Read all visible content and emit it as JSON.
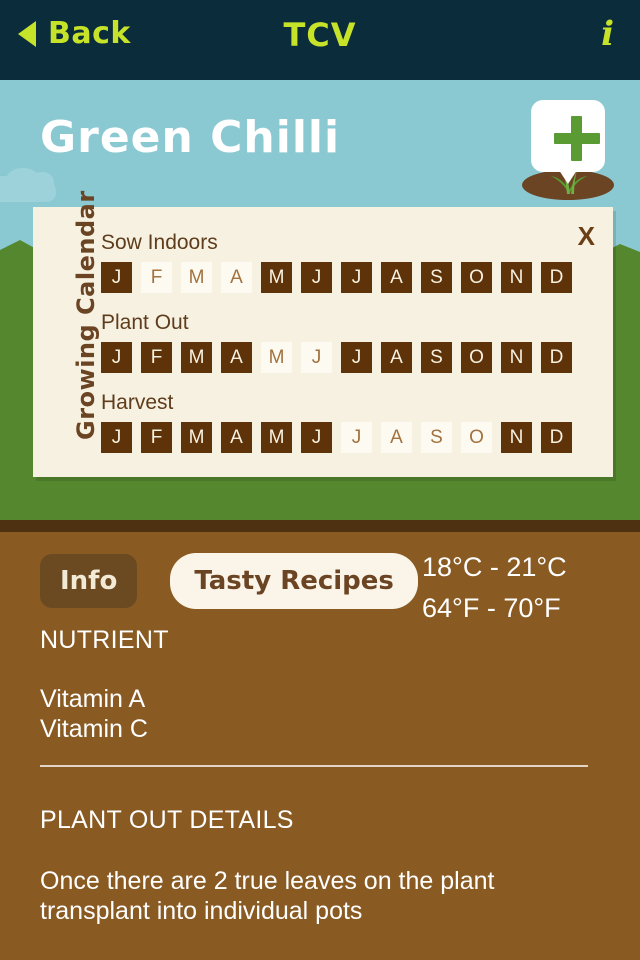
{
  "navbar": {
    "back_label": "Back",
    "title": "TCV",
    "info_icon": "i",
    "back_icon": "back-triangle-icon"
  },
  "scene": {
    "plant_title": "Green Chilli",
    "add_button_icon": "plus-icon"
  },
  "calendar": {
    "side_label": "Growing Calendar",
    "close_label": "X",
    "months": [
      "J",
      "F",
      "M",
      "A",
      "M",
      "J",
      "J",
      "A",
      "S",
      "O",
      "N",
      "D"
    ],
    "rows": [
      {
        "label": "Sow Indoors",
        "active": [
          false,
          true,
          true,
          true,
          false,
          false,
          false,
          false,
          false,
          false,
          false,
          false
        ]
      },
      {
        "label": "Plant Out",
        "active": [
          false,
          false,
          false,
          false,
          true,
          true,
          false,
          false,
          false,
          false,
          false,
          false
        ]
      },
      {
        "label": "Harvest",
        "active": [
          false,
          false,
          false,
          false,
          false,
          false,
          true,
          true,
          true,
          true,
          false,
          false
        ]
      }
    ]
  },
  "soil": {
    "tabs": [
      {
        "label": "Info",
        "selected": true
      },
      {
        "label": "Tasty Recipes",
        "selected": false
      }
    ],
    "temperature": {
      "celsius": "18°C - 21°C",
      "fahrenheit": "64°F - 70°F"
    },
    "nutrient": {
      "heading": "NUTRIENT",
      "items": [
        "Vitamin A",
        "Vitamin C"
      ]
    },
    "plant_out": {
      "heading": "PLANT OUT DETAILS",
      "text": "Once there are 2 true leaves on the plant transplant into individual pots"
    }
  },
  "colors": {
    "navbar_bg": "#0a2c3b",
    "accent_lime": "#c6e229",
    "sky": "#8bc9d2",
    "grass": "#55882e",
    "soil": "#8a5a23",
    "soil_dark": "#4d3110",
    "card_bg": "#f7f1e1",
    "month_off": "#5e3309",
    "month_on": "#fdfaf2",
    "brown_text": "#6b4423"
  }
}
